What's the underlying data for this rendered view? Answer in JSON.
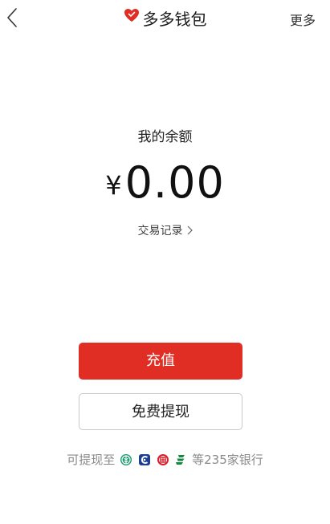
{
  "header": {
    "back_icon": "chevron-left-icon",
    "title": "多多钱包",
    "title_icon": "red-heart-icon",
    "more_label": "更多"
  },
  "wallet": {
    "balance_label": "我的余额",
    "currency_symbol": "¥",
    "balance": "0.00",
    "transactions_label": "交易记录"
  },
  "actions": {
    "recharge_label": "充值",
    "withdraw_label": "免费提现"
  },
  "banks": {
    "prefix": "可提现至",
    "suffix": "等235家银行",
    "icons": [
      "agricultural-bank-icon",
      "bank-of-communications-icon",
      "icbc-icon",
      "postal-savings-bank-icon"
    ]
  },
  "colors": {
    "brand_red": "#e02e24",
    "agricultural_green": "#1a9a6e",
    "comm_blue": "#1c3f94",
    "icbc_red": "#d71e2a",
    "postal_green": "#0f8a3e"
  }
}
